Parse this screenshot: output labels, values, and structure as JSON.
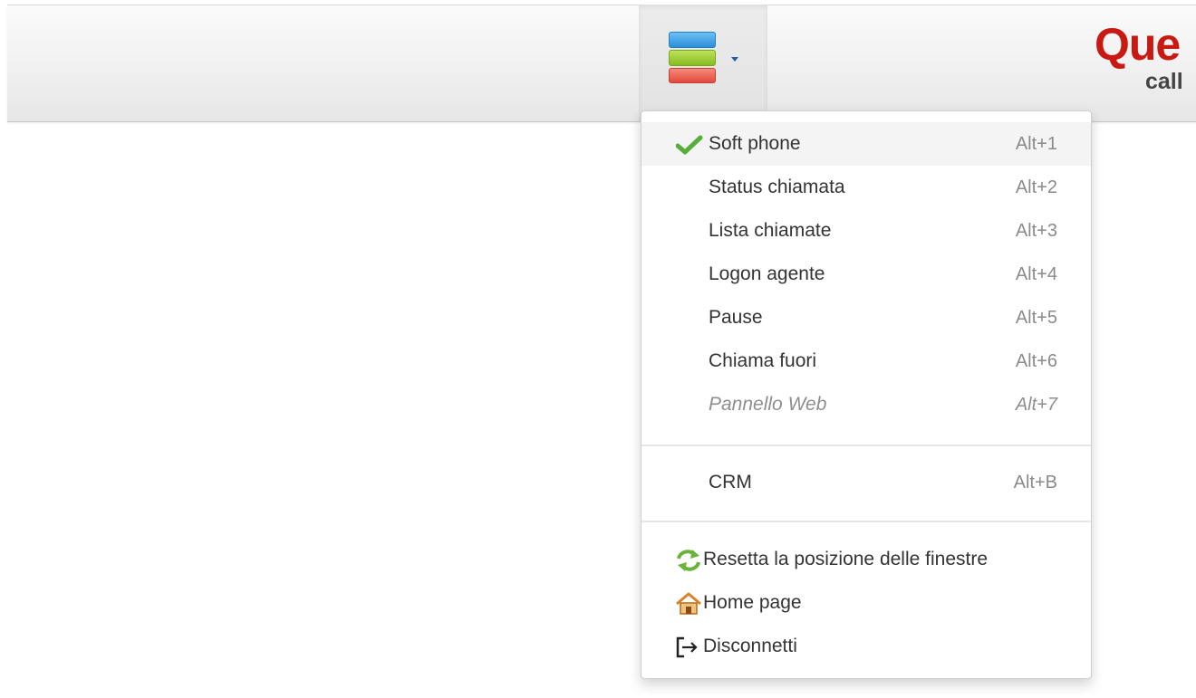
{
  "brand": {
    "name": "Que",
    "subtitle": "call"
  },
  "header": {
    "menu_icon": "stacked-layers-icon",
    "menu_caret": "chevron-down-icon",
    "colors": {
      "bar_top": "#3aa0e8",
      "bar_middle": "#92c830",
      "bar_bottom": "#e9594c",
      "brand_red": "#c81a12",
      "check_green": "#57ae3a"
    }
  },
  "menu": {
    "items": [
      {
        "label": "Soft phone",
        "shortcut": "Alt+1",
        "checked": true,
        "icon": "check-icon"
      },
      {
        "label": "Status chiamata",
        "shortcut": "Alt+2"
      },
      {
        "label": "Lista chiamate",
        "shortcut": "Alt+3"
      },
      {
        "label": "Logon agente",
        "shortcut": "Alt+4"
      },
      {
        "label": "Pause",
        "shortcut": "Alt+5"
      },
      {
        "label": "Chiama fuori",
        "shortcut": "Alt+6"
      },
      {
        "label": "Pannello Web",
        "shortcut": "Alt+7",
        "disabled": true
      }
    ],
    "crm": {
      "label": "CRM",
      "shortcut": "Alt+B"
    },
    "actions": [
      {
        "label": "Resetta la posizione delle finestre",
        "icon": "refresh-arrows-icon"
      },
      {
        "label": "Home page",
        "icon": "home-icon"
      },
      {
        "label": "Disconnetti",
        "icon": "logout-icon"
      }
    ]
  }
}
